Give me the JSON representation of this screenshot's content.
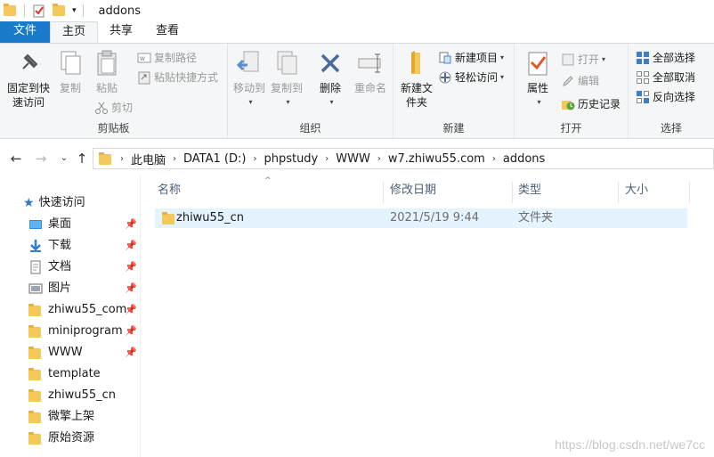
{
  "titlebar": {
    "title": "addons"
  },
  "tabs": [
    "文件",
    "主页",
    "共享",
    "查看"
  ],
  "ribbon": {
    "clipboard": {
      "label": "剪贴板",
      "pin_label": "固定到快速访问",
      "copy_label": "复制",
      "paste_label": "粘贴",
      "copy_path_label": "复制路径",
      "paste_shortcut_label": "粘贴快捷方式",
      "cut_label": "剪切"
    },
    "organize": {
      "label": "组织",
      "move_to_label": "移动到",
      "copy_to_label": "复制到",
      "delete_label": "删除",
      "rename_label": "重命名"
    },
    "new": {
      "label": "新建",
      "new_folder_label": "新建文件夹",
      "new_item_label": "新建项目",
      "easy_access_label": "轻松访问"
    },
    "open": {
      "label": "打开",
      "properties_label": "属性",
      "open_label": "打开",
      "edit_label": "编辑",
      "history_label": "历史记录"
    },
    "select": {
      "label": "选择",
      "select_all_label": "全部选择",
      "select_none_label": "全部取消",
      "invert_label": "反向选择"
    }
  },
  "breadcrumb": [
    "此电脑",
    "DATA1 (D:)",
    "phpstudy",
    "WWW",
    "w7.zhiwu55.com",
    "addons"
  ],
  "navpane": {
    "quick_access_label": "快速访问",
    "items": [
      {
        "label": "桌面",
        "icon": "desktop-icon",
        "pinned": true
      },
      {
        "label": "下载",
        "icon": "download-icon",
        "pinned": true
      },
      {
        "label": "文档",
        "icon": "document-icon",
        "pinned": true
      },
      {
        "label": "图片",
        "icon": "picture-icon",
        "pinned": true
      },
      {
        "label": "zhiwu55_com",
        "icon": "folder-icon",
        "pinned": true
      },
      {
        "label": "miniprogram",
        "icon": "folder-icon",
        "pinned": true
      },
      {
        "label": "WWW",
        "icon": "folder-icon",
        "pinned": true
      },
      {
        "label": "template",
        "icon": "folder-icon",
        "pinned": false
      },
      {
        "label": "zhiwu55_cn",
        "icon": "folder-icon",
        "pinned": false
      },
      {
        "label": "微擎上架",
        "icon": "folder-icon",
        "pinned": false
      },
      {
        "label": "原始资源",
        "icon": "folder-icon",
        "pinned": false
      }
    ]
  },
  "columns": [
    "名称",
    "修改日期",
    "类型",
    "大小"
  ],
  "files": [
    {
      "name": "zhiwu55_cn",
      "modified": "2021/5/19 9:44",
      "type": "文件夹",
      "size": ""
    }
  ],
  "watermark": "https://blog.csdn.net/we7cc",
  "colors": {
    "accent": "#1979ca",
    "selection": "#e5f3ff",
    "folder": "#f4c95a"
  }
}
